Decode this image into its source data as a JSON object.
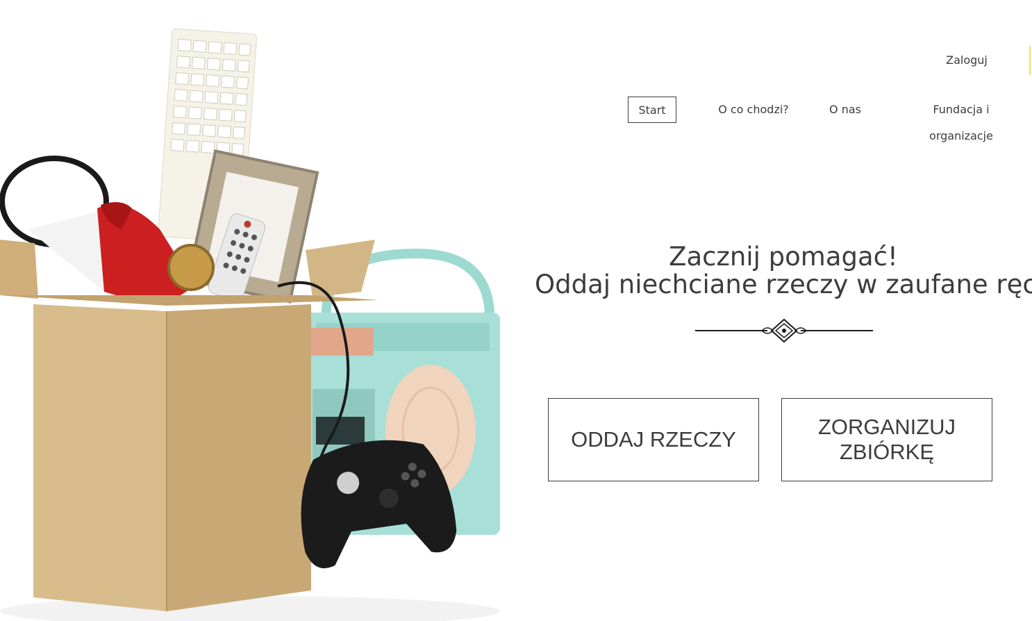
{
  "header": {
    "login_label": "Zaloguj",
    "login_accent_color": "#f0e44a"
  },
  "nav": {
    "items": [
      {
        "label": "Start",
        "active": true
      },
      {
        "label": "O co chodzi?",
        "active": false
      },
      {
        "label": "O nas",
        "active": false
      },
      {
        "label": "Fundacja i organizacje",
        "active": false
      }
    ]
  },
  "hero": {
    "headline_line1": "Zacznij pomagać!",
    "headline_line2": "Oddaj niechciane rzeczy w zaufane ręce.",
    "buttons": {
      "give_label": "ODDAJ RZECZY",
      "organize_line1": "ZORGANIZUJ",
      "organize_line2": "ZBIÓRKĘ"
    },
    "image_description_icon": "donation-box-illustration"
  },
  "colors": {
    "text": "#3c3c3c",
    "background": "#ffffff",
    "box": "#d9bc8c",
    "radio": "#a8e0d8"
  }
}
